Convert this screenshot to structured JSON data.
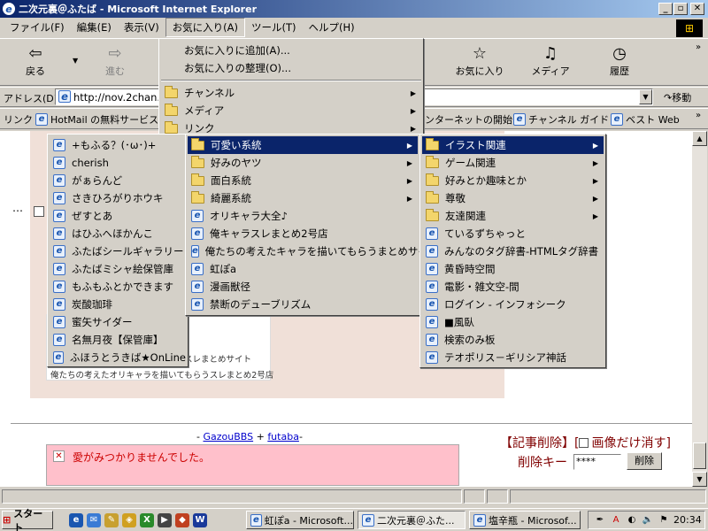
{
  "window": {
    "title": "二次元裏＠ふたば - Microsoft Internet Explorer"
  },
  "menubar": {
    "items": [
      "ファイル(F)",
      "編集(E)",
      "表示(V)",
      "お気に入り(A)",
      "ツール(T)",
      "ヘルプ(H)"
    ]
  },
  "toolbar": {
    "back": "戻る",
    "forward": "進む",
    "favorites": "お気に入り",
    "media": "メディア",
    "history": "履歴"
  },
  "address": {
    "label": "アドレス(D)",
    "value": "http://nov.2chan.ne",
    "go": "移動"
  },
  "links": {
    "label": "リンク",
    "hotmail": "HotMail の無料サービス",
    "internet_start": "ンターネットの開始",
    "channel_guide": "チャンネル ガイド",
    "best_web": "ベスト Web"
  },
  "favorites_menu": {
    "add": "お気に入りに追加(A)...",
    "organize": "お気に入りの整理(O)...",
    "channel": "チャンネル",
    "media": "メディア",
    "links": "リンク"
  },
  "left_menu": [
    "+もふる？(･ω･)+",
    "cherish",
    "がぁらんど",
    "さきひろがりホウキ",
    "ぜすとあ",
    "はひふへほかんこ",
    "ふたばシールギャラリー",
    "ふたばミシャ絵保管庫",
    "もふもふとかできます",
    "炭酸珈琲",
    "蜜矢サイダー",
    "名無月夜【保管庫】",
    "ふほうとうきば★OnLine"
  ],
  "mid_menu": {
    "folders": [
      "可愛い系統",
      "好みのヤツ",
      "面白系統",
      "綺麗系統"
    ],
    "links": [
      "オリキャラ大全♪",
      "俺キャラスレまとめ2号店",
      "俺たちの考えたキャラを描いてもらうまとめサイト",
      "虹ぽa",
      "漫画獣径",
      "禁断のデューブリズム"
    ]
  },
  "right_menu": {
    "folders": [
      "イラスト関連",
      "ゲーム関連",
      "好みとか趣味とか",
      "尊敬",
      "友達関連"
    ],
    "links": [
      "ているずちゃっと",
      "みんなのタグ辞書-HTMLタグ辞書",
      "黄昏時空間",
      "電影・雑文空-間",
      "ログイン - インフォシーク",
      "■風臥",
      "検索のみ板",
      "テオポリス－ギリシア神話"
    ]
  },
  "page": {
    "behind_text_1": "スレまとめサイト",
    "behind_text_2": "俺たちの考えたオリキャラを描いてもらうスレまとめ2号店",
    "dots": "…",
    "gazou_prefix": "- ",
    "gazou_link": "GazouBBS",
    "plus": " + ",
    "futaba_link": "futaba",
    "gazou_suffix": "-",
    "error_text": "愛がみつかりませんでした。",
    "delete_title_1": "【記事削除】[",
    "delete_title_2": "画像だけ消す]",
    "delete_key_label": "削除キー",
    "delete_key_value": "****",
    "delete_button": "削除"
  },
  "taskbar": {
    "start": "スタート",
    "tasks": [
      "虹ぽa - Microsoft...",
      "二次元裏＠ふた...",
      "塩辛瓶 - Microsof..."
    ],
    "clock": "20:34"
  },
  "colors": {
    "menu_highlight": "#0a246a",
    "error_pink": "#ffc0cb",
    "title_start": "#0a246a"
  }
}
